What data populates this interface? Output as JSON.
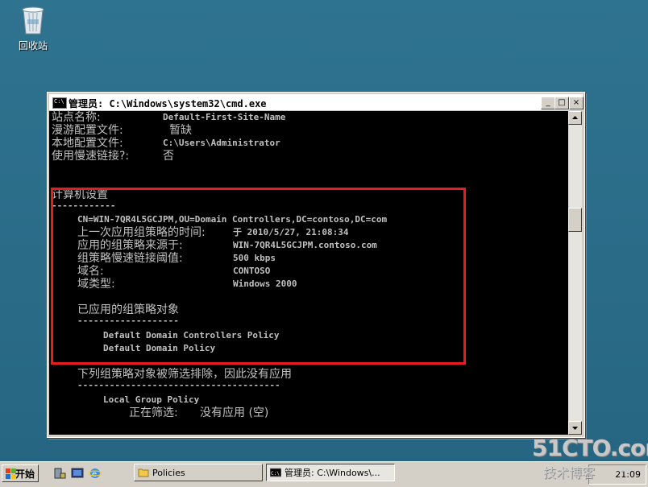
{
  "desktop": {
    "recycle_bin_label": "回收站"
  },
  "window": {
    "title": "管理员: C:\\Windows\\system32\\cmd.exe",
    "controls": {
      "minimize": "_",
      "maximize": "□",
      "close": "×"
    }
  },
  "console": {
    "site_name_label": "站点名称:",
    "site_name_value": "Default-First-Site-Name",
    "roaming_profile_label": "漫游配置文件:",
    "roaming_profile_value": "暂缺",
    "local_profile_label": "本地配置文件:",
    "local_profile_value": "C:\\Users\\Administrator",
    "slow_link_label": "使用慢速链接?:",
    "slow_link_value": "否",
    "computer_settings_header": "计算机设置",
    "computer_settings_rule": "------------",
    "computer_dn": "CN=WIN-7QR4L5GCJPM,OU=Domain Controllers,DC=contoso,DC=com",
    "last_applied_label": "上一次应用组策略的时间:",
    "last_applied_value": "于 2010/5/27, 21:08:34",
    "gp_source_label": "应用的组策略来源于:",
    "gp_source_value": "WIN-7QR4L5GCJPM.contoso.com",
    "slow_link_threshold_label": "组策略慢速链接阈值:",
    "slow_link_threshold_value": "500 kbps",
    "domain_name_label": "域名:",
    "domain_name_value": "CONTOSO",
    "domain_type_label": "域类型:",
    "domain_type_value": "Windows 2000",
    "applied_gpo_header": "已应用的组策略对象",
    "applied_gpo_rule": "-------------------",
    "applied_gpos": [
      "Default Domain Controllers Policy",
      "Default Domain Policy"
    ],
    "filtered_header": "下列组策略对象被筛选排除，因此没有应用",
    "filtered_rule": "--------------------------------------",
    "filtered_gpo": "Local Group Policy",
    "filtering_label": "正在筛选:",
    "filtering_value": "没有应用 (空)"
  },
  "taskbar": {
    "start_label": "开始",
    "tasks": [
      "Policies",
      "管理员: C:\\Windows\\..."
    ],
    "clock": "21:09"
  },
  "watermark": {
    "brand": "51CTO.com",
    "subtitle": "技术博客",
    "tag": "Blog"
  },
  "colors": {
    "console_bg": "#000000",
    "console_text": "#c0c0c0",
    "highlight": "#e81c1c",
    "desktop": "#2c6e8a"
  }
}
